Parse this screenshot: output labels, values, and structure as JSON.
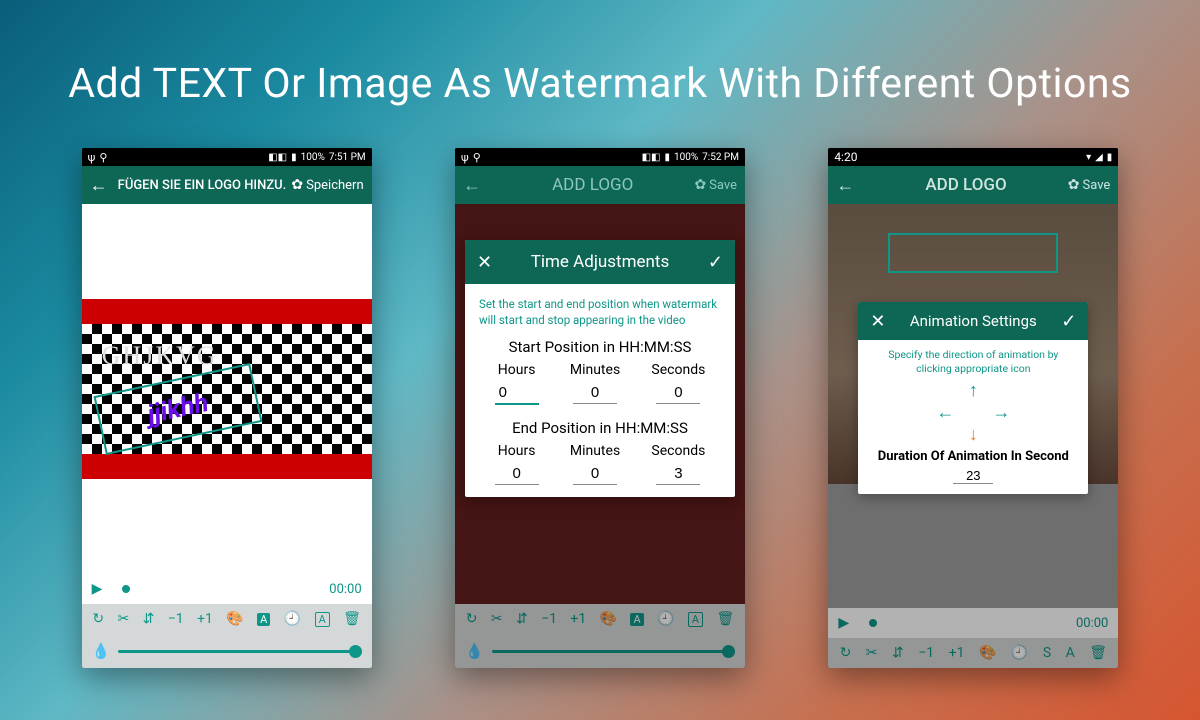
{
  "headline": "Add TEXT Or Image As Watermark With Different Options",
  "phone1": {
    "status": {
      "battery": "100%",
      "time": "7:51 PM"
    },
    "title": "FÜGEN SIE EIN LOGO HINZU.",
    "save": "Speichern",
    "watermark1": "GHJKVG",
    "watermark2": "jjikhh",
    "playtime": "00:00",
    "toolbar": {
      "minus": "−1",
      "plus": "+1"
    }
  },
  "phone2": {
    "status": {
      "battery": "100%",
      "time": "7:52 PM"
    },
    "title": "ADD LOGO",
    "save": "Save",
    "dialog": {
      "title": "Time Adjustments",
      "hint": "Set the start and end position when watermark will start and stop appearing in the video",
      "start_label": "Start Position in HH:MM:SS",
      "end_label": "End Position in HH:MM:SS",
      "hours": "Hours",
      "minutes": "Minutes",
      "seconds": "Seconds",
      "start": {
        "h": "0",
        "m": "0",
        "s": "0"
      },
      "end": {
        "h": "0",
        "m": "0",
        "s": "3"
      }
    }
  },
  "phone3": {
    "status": {
      "time": "4:20"
    },
    "title": "ADD LOGO",
    "save": "Save",
    "dialog": {
      "title": "Animation Settings",
      "hint": "Specify the direction of animation by clicking appropriate icon",
      "duration_label": "Duration Of Animation In Second",
      "duration": "23"
    },
    "playtime": "00:00",
    "toolbar_extra": {
      "s": "S",
      "a": "A"
    }
  }
}
